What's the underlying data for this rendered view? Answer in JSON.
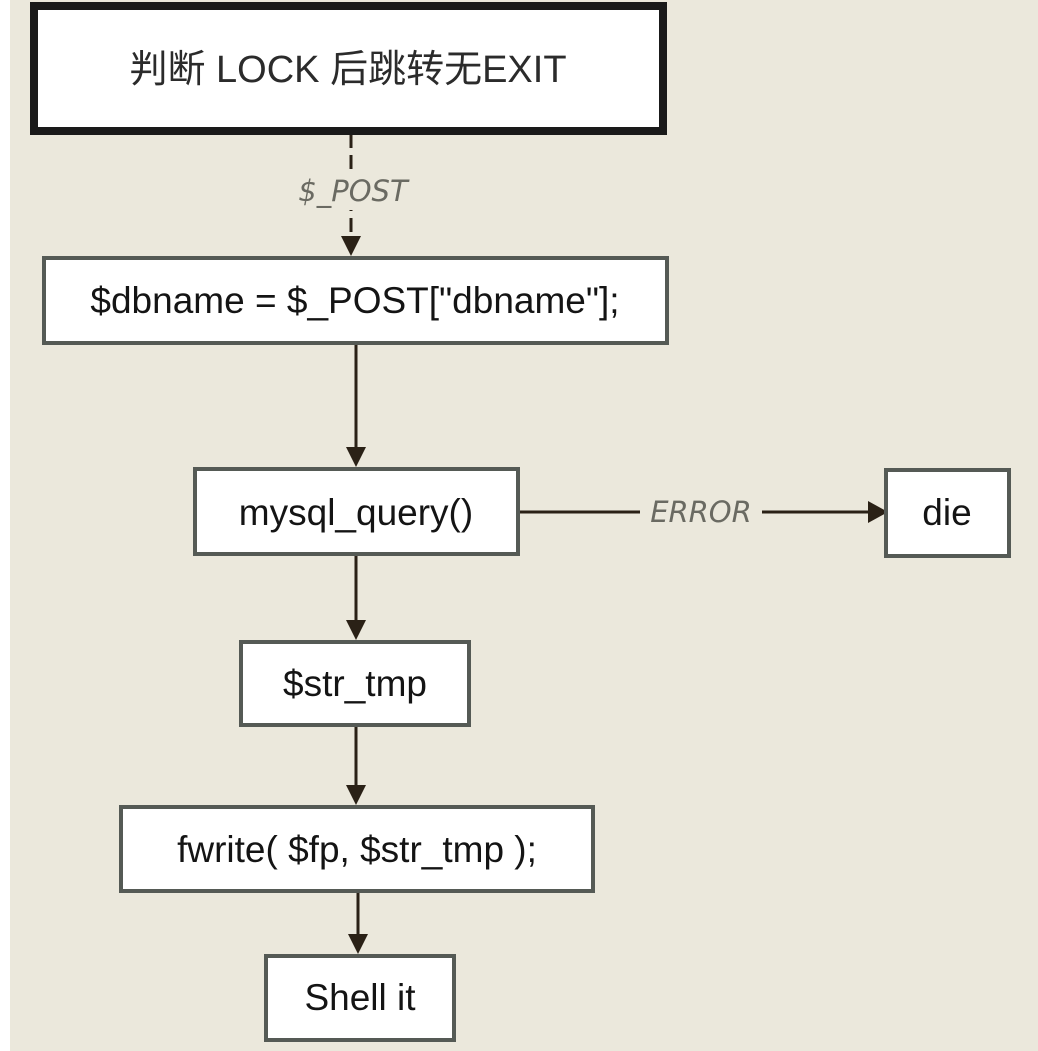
{
  "diagram": {
    "nodes": [
      {
        "id": "lock-check",
        "label": "判断 LOCK 后跳转无EXIT"
      },
      {
        "id": "dbname",
        "label": "$dbname = $_POST[\"dbname\"];"
      },
      {
        "id": "mysql-query",
        "label": "mysql_query()"
      },
      {
        "id": "die",
        "label": "die"
      },
      {
        "id": "str-tmp",
        "label": "$str_tmp"
      },
      {
        "id": "fwrite",
        "label": "fwrite( $fp, $str_tmp );"
      },
      {
        "id": "shell",
        "label": "Shell it"
      }
    ],
    "edges": [
      {
        "from": "lock-check",
        "to": "dbname",
        "label": "$_POST",
        "style": "dashed"
      },
      {
        "from": "dbname",
        "to": "mysql-query",
        "label": "",
        "style": "solid"
      },
      {
        "from": "mysql-query",
        "to": "die",
        "label": "ERROR",
        "style": "solid"
      },
      {
        "from": "mysql-query",
        "to": "str-tmp",
        "label": "",
        "style": "solid"
      },
      {
        "from": "str-tmp",
        "to": "fwrite",
        "label": "",
        "style": "solid"
      },
      {
        "from": "fwrite",
        "to": "shell",
        "label": "",
        "style": "solid"
      }
    ]
  },
  "colors": {
    "background": "#ebe8dc",
    "node_fill": "#ffffff",
    "node_border": "#555a55",
    "start_border": "#1a1a1a",
    "arrow": "#2a2116",
    "edge_label": "#6a6a62"
  }
}
